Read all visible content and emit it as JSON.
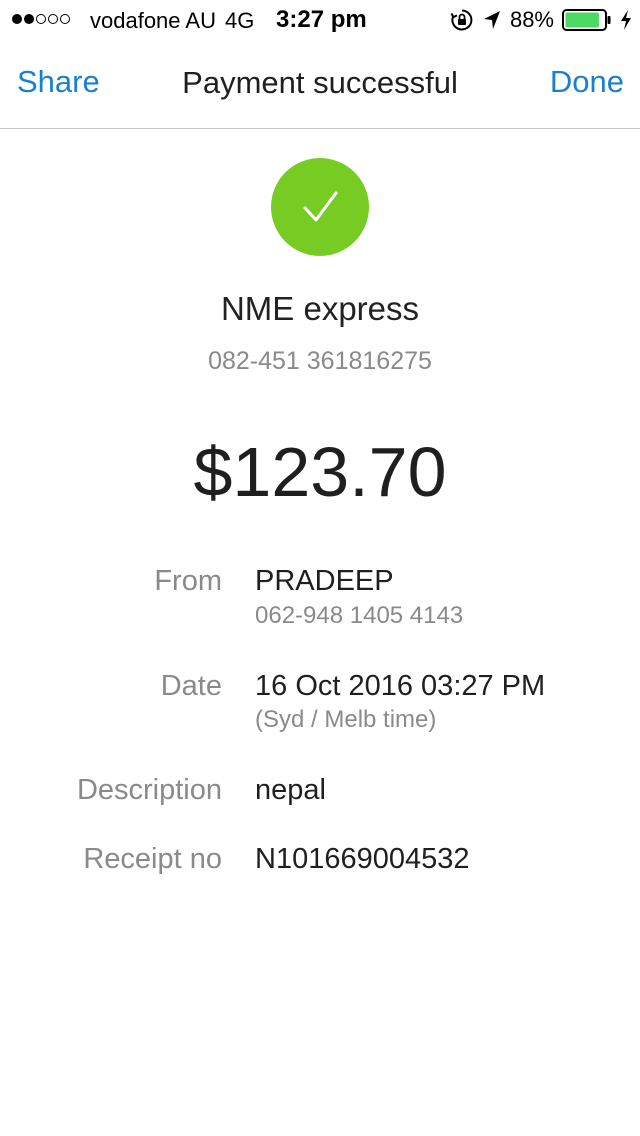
{
  "status_bar": {
    "signal_strength": "2 of 5",
    "carrier": "vodafone AU",
    "network": "4G",
    "time": "3:27 pm",
    "battery_percent": "88%",
    "battery_level": 0.88,
    "battery_color": "#4cd964",
    "icons": [
      "orientation-lock-icon",
      "location-arrow-icon",
      "battery-icon",
      "charging-bolt-icon"
    ]
  },
  "nav": {
    "left_button": "Share",
    "title": "Payment successful",
    "right_button": "Done",
    "accent_color": "#1a7fd1"
  },
  "payment": {
    "status_icon": "checkmark-icon",
    "status_color": "#76cc23",
    "payee_name": "NME express",
    "payee_account": "082-451 361816275",
    "amount": "$123.70"
  },
  "details": {
    "from": {
      "label": "From",
      "value": "PRADEEP",
      "sub": "062-948 1405 4143"
    },
    "date": {
      "label": "Date",
      "value": "16 Oct 2016 03:27 PM",
      "sub": "(Syd / Melb time)"
    },
    "description": {
      "label": "Description",
      "value": "nepal"
    },
    "receipt": {
      "label": "Receipt no",
      "value": "N101669004532"
    }
  }
}
